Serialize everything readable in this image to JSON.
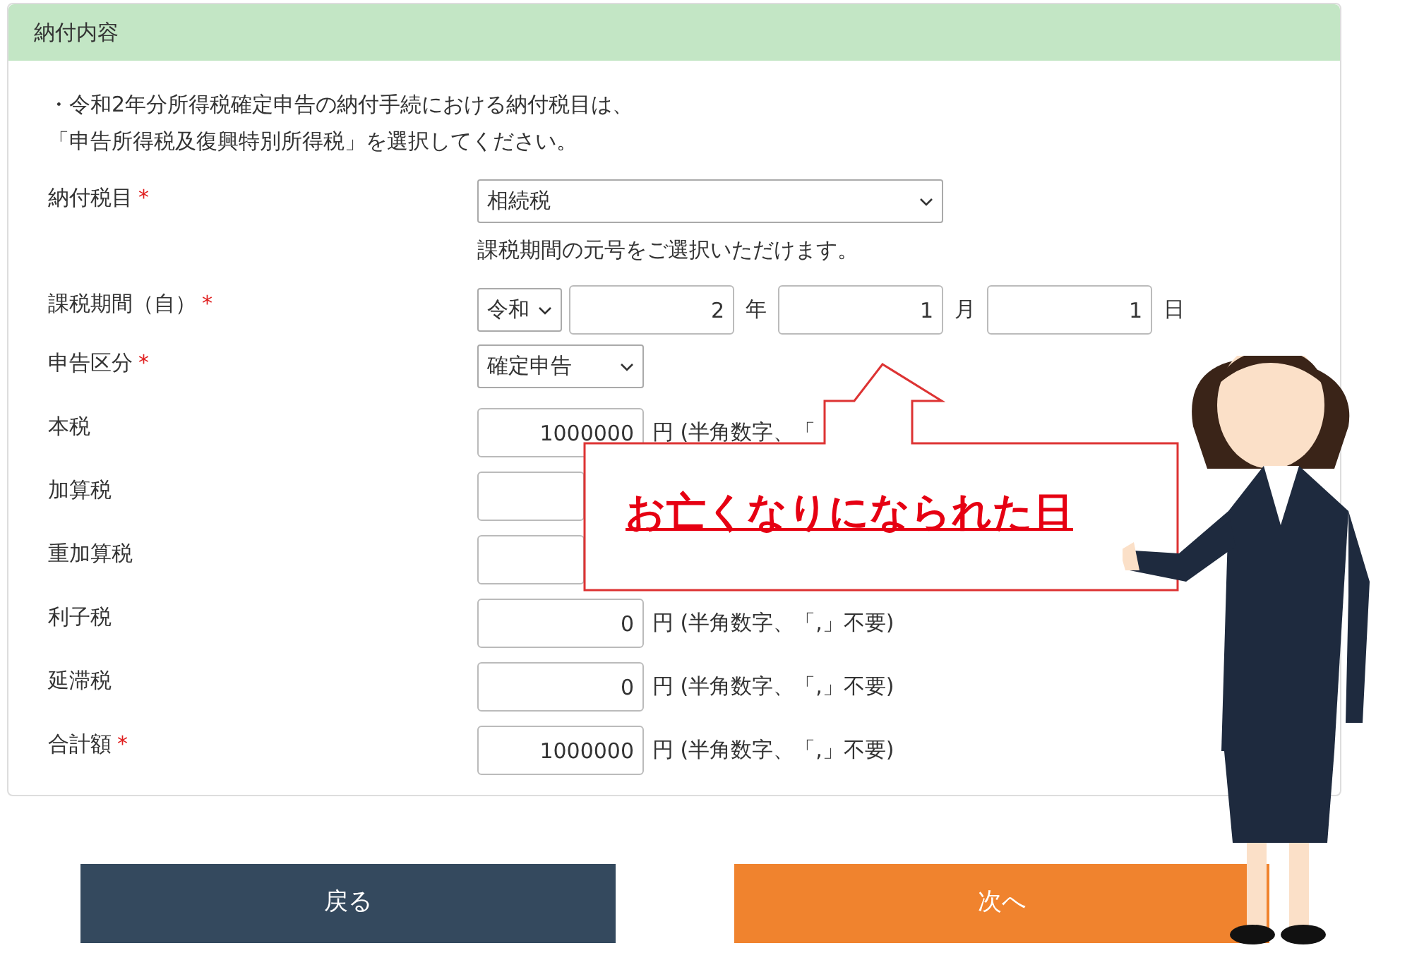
{
  "panel": {
    "title": "納付内容",
    "notice": [
      "・令和2年分所得税確定申告の納付手続における納付税目は、",
      "「申告所得税及復興特別所得税」を選択してください。"
    ]
  },
  "fields": [
    {
      "kind": "select",
      "label": "納付税目",
      "mark": "*",
      "value": "相続税",
      "hint": "課税期間の元号をご選択いただけます。",
      "wide": true
    },
    {
      "kind": "date",
      "label": "課税期間（自）",
      "mark": "*",
      "era": "令和",
      "parts": [
        {
          "value": "2",
          "unit": "年"
        },
        {
          "value": "1",
          "unit": "月"
        },
        {
          "value": "1",
          "unit": "日"
        }
      ]
    },
    {
      "kind": "select",
      "label": "申告区分",
      "mark": "*",
      "value": "確定申告",
      "wide": false
    },
    {
      "kind": "amount",
      "label": "本税",
      "value": "1000000",
      "note": "円 (半角数字、「"
    },
    {
      "kind": "amount",
      "label": "加算税"
    },
    {
      "kind": "amount",
      "label": "重加算税"
    },
    {
      "kind": "amount",
      "label": "利子税",
      "value": "0",
      "note": "円 (半角数字、「,」不要)"
    },
    {
      "kind": "amount",
      "label": "延滞税",
      "value": "0",
      "note": "円 (半角数字、「,」不要)"
    },
    {
      "kind": "amount",
      "label": "合計額",
      "mark": "*",
      "value": "1000000",
      "note": "円 (半角数字、「,」不要)"
    }
  ],
  "callout": {
    "text": "お亡くなりになられた日"
  },
  "buttons": [
    {
      "kind": "back",
      "label": "戻る"
    },
    {
      "kind": "next",
      "label": "次へ"
    }
  ]
}
